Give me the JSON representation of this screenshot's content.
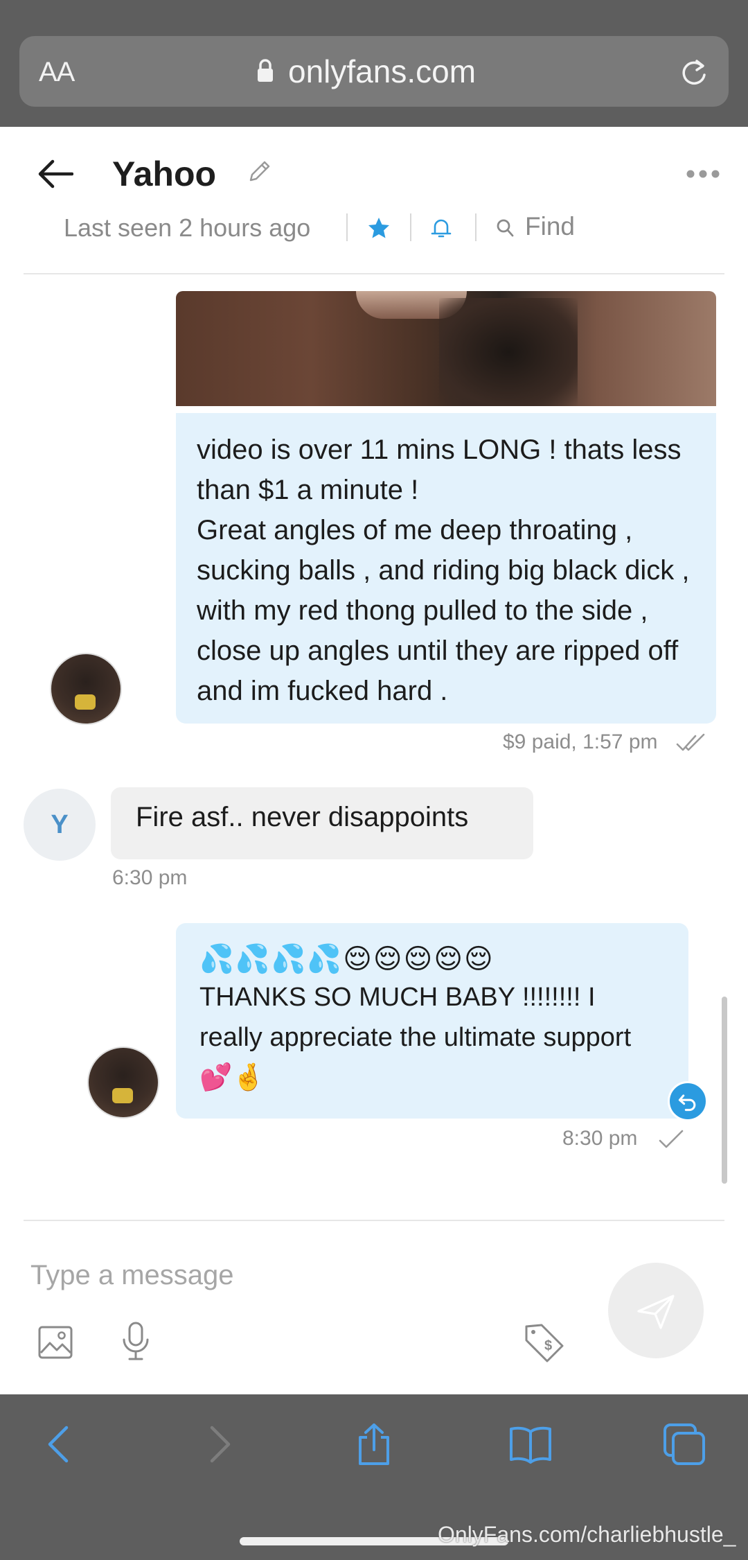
{
  "browser": {
    "text_size_label": "AA",
    "url": "onlyfans.com"
  },
  "header": {
    "name": "Yahoo",
    "last_seen": "Last seen 2 hours ago",
    "find_label": "Find"
  },
  "messages": [
    {
      "direction": "outgoing",
      "has_media": true,
      "text": "video is over 11 mins LONG ! thats less than $1 a minute !\nGreat angles of me deep throating , sucking balls , and riding big black dick , with my red thong pulled to the side , close up angles until they are ripped off and im fucked hard .",
      "meta": "$9 paid, 1:57 pm"
    },
    {
      "direction": "incoming",
      "avatar_letter": "Y",
      "text": "Fire asf.. never disappoints",
      "time": "6:30 pm"
    },
    {
      "direction": "outgoing",
      "emoji": "💦💦💦💦😌😌😌😌😌",
      "text": "THANKS SO MUCH BABY !!!!!!!! I really appreciate the ultimate support 💕🤞",
      "time": "8:30 pm"
    }
  ],
  "composer": {
    "placeholder": "Type a message"
  },
  "watermark": "OnlyFans.com/charliebhustle_",
  "colors": {
    "accent": "#2b9be0",
    "outgoing_bubble": "#e3f2fc",
    "incoming_bubble": "#f0f0f0",
    "safari_chrome": "#5e5e5e"
  }
}
